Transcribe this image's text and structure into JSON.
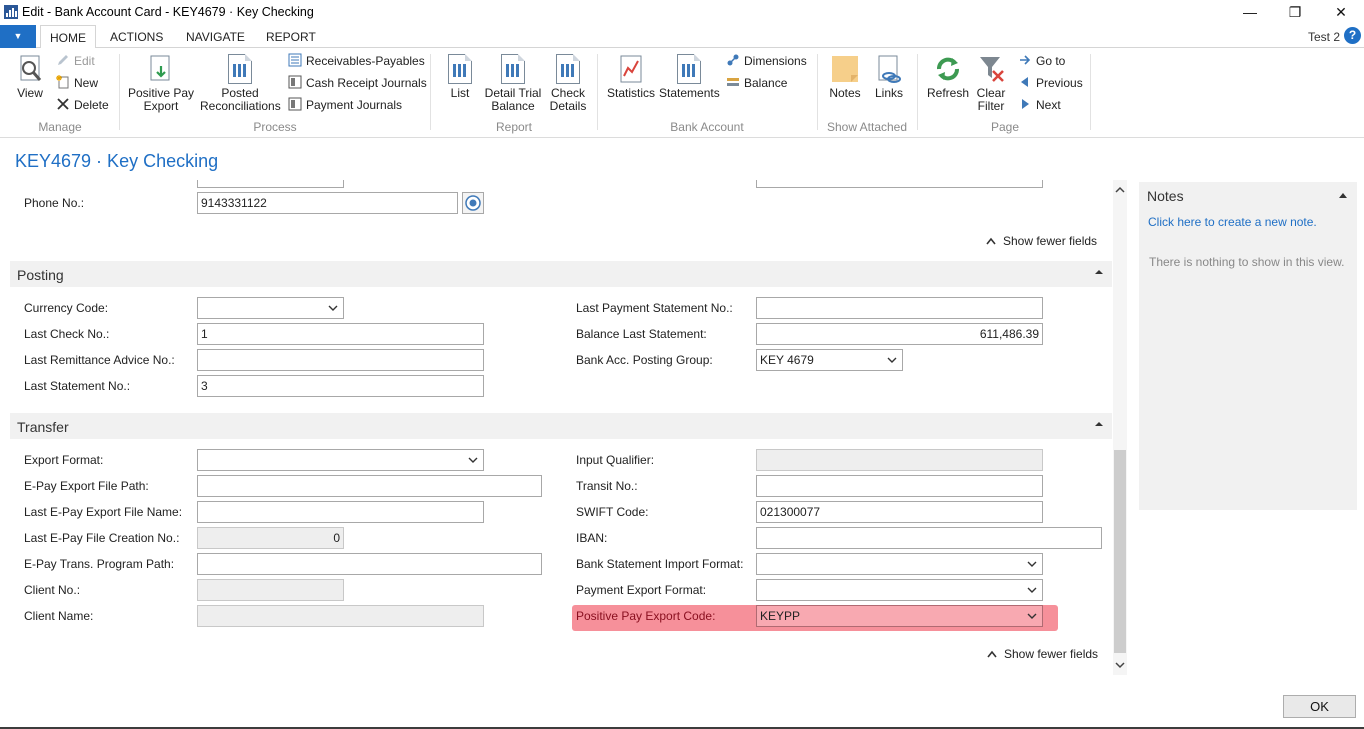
{
  "window": {
    "title": "Edit - Bank Account Card - KEY4679 · Key Checking",
    "minimize": "—",
    "restore": "❐",
    "close": "✕"
  },
  "tabs": [
    {
      "label": "HOME"
    },
    {
      "label": "ACTIONS"
    },
    {
      "label": "NAVIGATE"
    },
    {
      "label": "REPORT"
    }
  ],
  "menu_glyph": "▼",
  "user": "Test 2",
  "help_glyph": "?",
  "ribbon": {
    "manage": {
      "group": "Manage",
      "view": "View",
      "edit": "Edit",
      "new": "New",
      "delete": "Delete"
    },
    "process": {
      "group": "Process",
      "positive_pay_export": [
        "Positive Pay",
        "Export"
      ],
      "posted_reconciliations": [
        "Posted",
        "Reconciliations"
      ],
      "receivables_payables": "Receivables-Payables",
      "cash_receipt_journals": "Cash Receipt Journals",
      "payment_journals": "Payment Journals"
    },
    "report": {
      "group": "Report",
      "list": "List",
      "detail_trial_balance": [
        "Detail Trial",
        "Balance"
      ],
      "check_details": [
        "Check",
        "Details"
      ]
    },
    "bank_account": {
      "group": "Bank Account",
      "statistics": "Statistics",
      "statements": "Statements",
      "dimensions": "Dimensions",
      "balance": "Balance"
    },
    "show_attached": {
      "group": "Show Attached",
      "notes": "Notes",
      "links": "Links"
    },
    "page": {
      "group": "Page",
      "refresh": "Refresh",
      "clear_filter": [
        "Clear",
        "Filter"
      ],
      "go_to": "Go to",
      "previous": "Previous",
      "next": "Next"
    }
  },
  "page_title": "KEY4679 · Key Checking",
  "general": {
    "phone_label": "Phone No.:",
    "phone_value": "9143331122",
    "show_fewer": "Show fewer fields"
  },
  "posting": {
    "title": "Posting",
    "currency_code_label": "Currency Code:",
    "currency_code_value": "",
    "last_check_no_label": "Last Check No.:",
    "last_check_no_value": "1",
    "last_remittance_label": "Last Remittance Advice No.:",
    "last_remittance_value": "",
    "last_statement_no_label": "Last Statement No.:",
    "last_statement_no_value": "3",
    "last_payment_statement_label": "Last Payment Statement No.:",
    "last_payment_statement_value": "",
    "balance_last_statement_label": "Balance Last Statement:",
    "balance_last_statement_value": "611,486.39",
    "posting_group_label": "Bank Acc. Posting Group:",
    "posting_group_value": "KEY 4679"
  },
  "transfer": {
    "title": "Transfer",
    "export_format_label": "Export Format:",
    "export_format_value": "",
    "epay_file_path_label": "E-Pay Export File Path:",
    "epay_file_path_value": "",
    "last_epay_file_name_label": "Last E-Pay Export File Name:",
    "last_epay_file_name_value": "",
    "last_epay_creation_no_label": "Last E-Pay File Creation No.:",
    "last_epay_creation_no_value": "0",
    "epay_trans_program_path_label": "E-Pay Trans. Program Path:",
    "epay_trans_program_path_value": "",
    "client_no_label": "Client No.:",
    "client_no_value": "",
    "client_name_label": "Client Name:",
    "client_name_value": "",
    "input_qualifier_label": "Input Qualifier:",
    "input_qualifier_value": "",
    "transit_no_label": "Transit No.:",
    "transit_no_value": "",
    "swift_code_label": "SWIFT Code:",
    "swift_code_value": "021300077",
    "iban_label": "IBAN:",
    "iban_value": "",
    "bank_statement_import_label": "Bank Statement Import Format:",
    "bank_statement_import_value": "",
    "payment_export_format_label": "Payment Export Format:",
    "payment_export_format_value": "",
    "positive_pay_export_code_label": "Positive Pay Export Code:",
    "positive_pay_export_code_value": "KEYPP",
    "show_fewer": "Show fewer fields"
  },
  "notes_panel": {
    "title": "Notes",
    "create_link": "Click here to create a new note.",
    "empty": "There is nothing to show in this view."
  },
  "ok_button": "OK",
  "colors": {
    "accent": "#1f6fc5",
    "highlight": "#f57c88",
    "section_bg": "#f1f1f1"
  }
}
